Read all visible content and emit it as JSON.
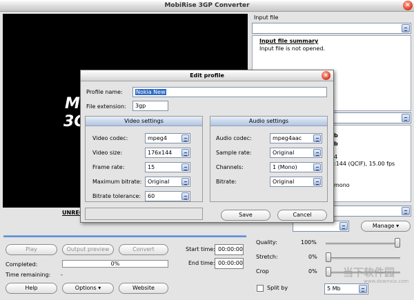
{
  "window": {
    "title": "MobiRise 3GP Converter",
    "close_glyph": "✕"
  },
  "preview": {
    "logo_line1": "M",
    "logo_line2": "3G",
    "unregistered": "UNREG"
  },
  "input_file": {
    "label": "Input file",
    "summary_title": "Input file summary",
    "summary_text": "Input file is not opened."
  },
  "output_summary_partial": {
    "line1": "4",
    "line2": ":144 (QCIF), 15.00 fps",
    "line3": "mono",
    "frag_b": "b",
    "frag_b2": "b"
  },
  "profile": {
    "manage_label": "Manage"
  },
  "toolbar": {
    "play": "Play",
    "output_preview": "Output preview",
    "convert": "Convert",
    "start_time_label": "Start time:",
    "start_time_value": "00:00:00",
    "end_time_label": "End time:",
    "end_time_value": "00:00:00",
    "completed_label": "Completed:",
    "completed_value": "0%",
    "time_remaining_label": "Time remaining:",
    "time_remaining_value": "-",
    "help": "Help",
    "options": "Options",
    "website": "Website"
  },
  "quality": {
    "quality_label": "Quality:",
    "quality_value": "100%",
    "quality_level": 1.0,
    "stretch_label": "Stretch:",
    "stretch_value": "0%",
    "stretch_level": 0.0,
    "crop_label": "Crop",
    "crop_value": "0%",
    "crop_level": 0.0,
    "split_label": "Split by",
    "split_value": "5 Mb"
  },
  "watermark": {
    "brand": "当下软件园",
    "url": "www.downxia.com"
  },
  "dialog": {
    "title": "Edit profile",
    "close_glyph": "✕",
    "profile_name_label": "Profile name:",
    "profile_name_value": "Nokia New",
    "file_extension_label": "File extension:",
    "file_extension_value": "3gp",
    "video": {
      "header": "Video settings",
      "codec_label": "Video codec:",
      "codec_value": "mpeg4",
      "size_label": "Video size:",
      "size_value": "176x144",
      "frame_rate_label": "Frame rate:",
      "frame_rate_value": "15",
      "max_bitrate_label": "Maximum bitrate:",
      "max_bitrate_value": "Original",
      "tolerance_label": "Bitrate tolerance:",
      "tolerance_value": "60"
    },
    "audio": {
      "header": "Audio settings",
      "codec_label": "Audio codec:",
      "codec_value": "mpeg4aac",
      "sample_rate_label": "Sample rate:",
      "sample_rate_value": "Original",
      "channels_label": "Channels:",
      "channels_value": "1 (Mono)",
      "bitrate_label": "Bitrate:",
      "bitrate_value": "Original"
    },
    "save": "Save",
    "cancel": "Cancel"
  }
}
